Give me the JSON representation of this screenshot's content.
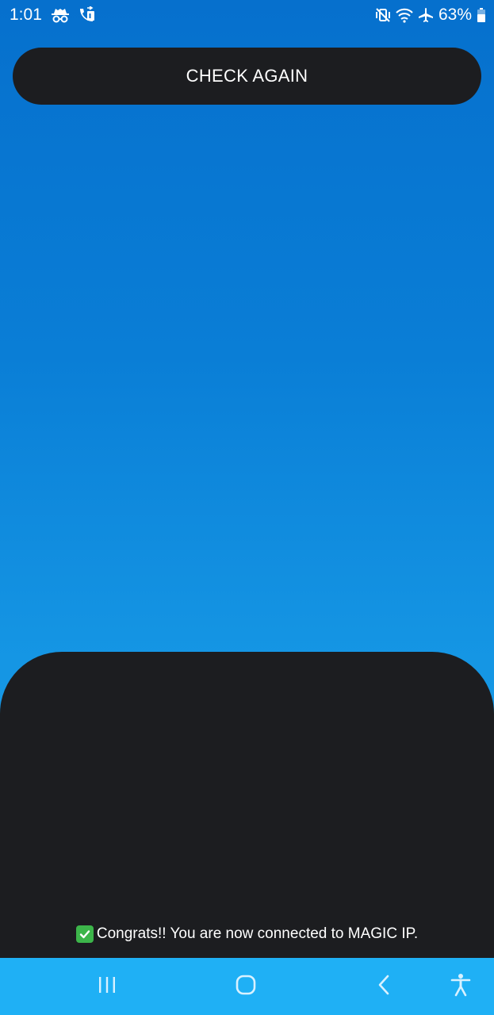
{
  "status_bar": {
    "time": "1:01",
    "battery": "63%",
    "icons_left": [
      "incognito-icon",
      "call-forward-icon"
    ],
    "icons_right": [
      "mute-vibrate-icon",
      "wifi-icon",
      "airplane-mode-icon",
      "battery-icon"
    ]
  },
  "main": {
    "check_again_label": "CHECK AGAIN"
  },
  "footer": {
    "status_message": "Congrats!! You are now connected to MAGIC IP."
  },
  "nav_bar": {
    "buttons": [
      "recent-apps-icon",
      "home-icon",
      "back-icon",
      "accessibility-icon"
    ]
  },
  "colors": {
    "gradient_top": "#0670cd",
    "gradient_bottom": "#1a9fea",
    "panel": "#1c1d20",
    "nav_bar": "#1fb0f5",
    "check_green": "#3cb54a"
  }
}
